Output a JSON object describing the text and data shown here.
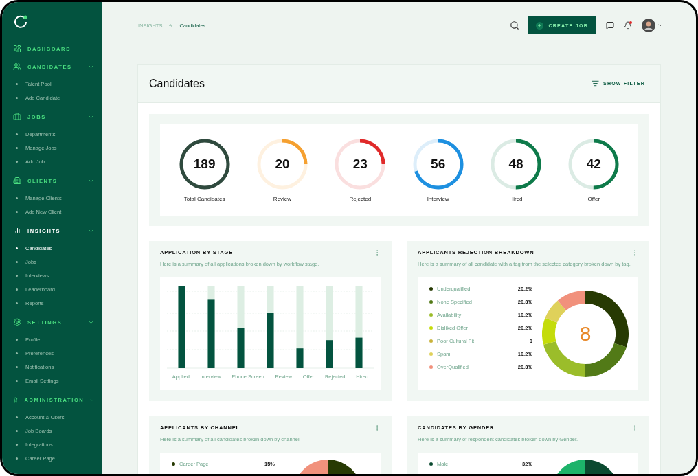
{
  "sidebar": {
    "sections": [
      {
        "label": "DASHBOARD",
        "active": false
      },
      {
        "label": "CANDIDATES",
        "active": false,
        "expandable": true,
        "items": [
          {
            "label": "Talent Pool",
            "selected": false
          },
          {
            "label": "Add Candidate",
            "selected": false
          }
        ]
      },
      {
        "label": "JOBS",
        "active": false,
        "expandable": true,
        "items": [
          {
            "label": "Departments",
            "selected": false
          },
          {
            "label": "Manage Jobs",
            "selected": false
          },
          {
            "label": "Add Job",
            "selected": false
          }
        ]
      },
      {
        "label": "CLIENTS",
        "active": false,
        "expandable": true,
        "items": [
          {
            "label": "Manage Clients",
            "selected": false
          },
          {
            "label": "Add New Client",
            "selected": false
          }
        ]
      },
      {
        "label": "INSIGHTS",
        "active": true,
        "expandable": true,
        "items": [
          {
            "label": "Candidates",
            "selected": true
          },
          {
            "label": "Jobs",
            "selected": false
          },
          {
            "label": "Interviews",
            "selected": false
          },
          {
            "label": "Leaderboard",
            "selected": false
          },
          {
            "label": "Reports",
            "selected": false
          }
        ]
      },
      {
        "label": "SETTINGS",
        "active": false,
        "expandable": true,
        "items": [
          {
            "label": "Profile",
            "selected": false
          },
          {
            "label": "Preferences",
            "selected": false
          },
          {
            "label": "Notifications",
            "selected": false
          },
          {
            "label": "Email Settings",
            "selected": false
          }
        ]
      },
      {
        "label": "ADMINISTRATION",
        "active": false,
        "expandable": true,
        "items": [
          {
            "label": "Account & Users",
            "selected": false
          },
          {
            "label": "Job Boards",
            "selected": false
          },
          {
            "label": "Integrations",
            "selected": false
          },
          {
            "label": "Career Page",
            "selected": false
          }
        ]
      }
    ]
  },
  "topbar": {
    "breadcrumb": [
      "INSIGHTS",
      "Candidates"
    ],
    "create_button": "CREATE JOB",
    "notification_dot": true
  },
  "page": {
    "title": "Candidates",
    "filter_button": "SHOW FILTER"
  },
  "stats": [
    {
      "value": "189",
      "label": "Total Candidates",
      "level": 1,
      "color": "#2f4a3e"
    },
    {
      "value": "20",
      "label": "Review",
      "level": 0.25,
      "color": "#f5a030"
    },
    {
      "value": "23",
      "label": "Rejected",
      "level": 0.25,
      "color": "#e02a2a"
    },
    {
      "value": "56",
      "label": "Interview",
      "level": 0.7,
      "color": "#1e90e0"
    },
    {
      "value": "48",
      "label": "Hired",
      "level": 0.5,
      "color": "#0e7a4a"
    },
    {
      "value": "42",
      "label": "Offer",
      "level": 0.5,
      "color": "#0e7a4a"
    }
  ],
  "stage_card": {
    "title": "APPLICATION BY STAGE",
    "subtitle": "Here is a summary of all applications broken down by workflow stage.",
    "categories": [
      "Applied",
      "Interview",
      "Phone Screen",
      "Review",
      "Offer",
      "Rejected",
      "Hired"
    ]
  },
  "rejection_card": {
    "title": "APPLICANTS REJECTION BREAKDOWN",
    "subtitle": "Here is a summary of all candidate with a tag from the selected category broken down by tag.",
    "center": "8",
    "legend": [
      {
        "label": "Underqualified",
        "value": "20.2%",
        "color": "#273a03"
      },
      {
        "label": "None Specified",
        "value": "20.3%",
        "color": "#527a17"
      },
      {
        "label": "Availability",
        "value": "10.2%",
        "color": "#9bbd2a"
      },
      {
        "label": "Disliked Offer",
        "value": "20.2%",
        "color": "#c4dc0a"
      },
      {
        "label": "Poor Cultural Fit",
        "value": "0",
        "color": "#c9b23a"
      },
      {
        "label": "Spam",
        "value": "10.2%",
        "color": "#dfd15a"
      },
      {
        "label": "OverQualified",
        "value": "20.3%",
        "color": "#f1917c"
      }
    ]
  },
  "channel_card": {
    "title": "APPLICANTS BY CHANNEL",
    "subtitle": "Here is a summary of all candidates broken down by channel.",
    "legend": [
      {
        "label": "Career Page",
        "value": "15%",
        "color": "#273a03"
      }
    ]
  },
  "gender_card": {
    "title": "CANDIDATES BY GENDER",
    "subtitle": "Here is a summary of respondent candidates broken down by Gender.",
    "legend": [
      {
        "label": "Male",
        "value": "32%",
        "color": "#0b4a30"
      }
    ]
  }
}
